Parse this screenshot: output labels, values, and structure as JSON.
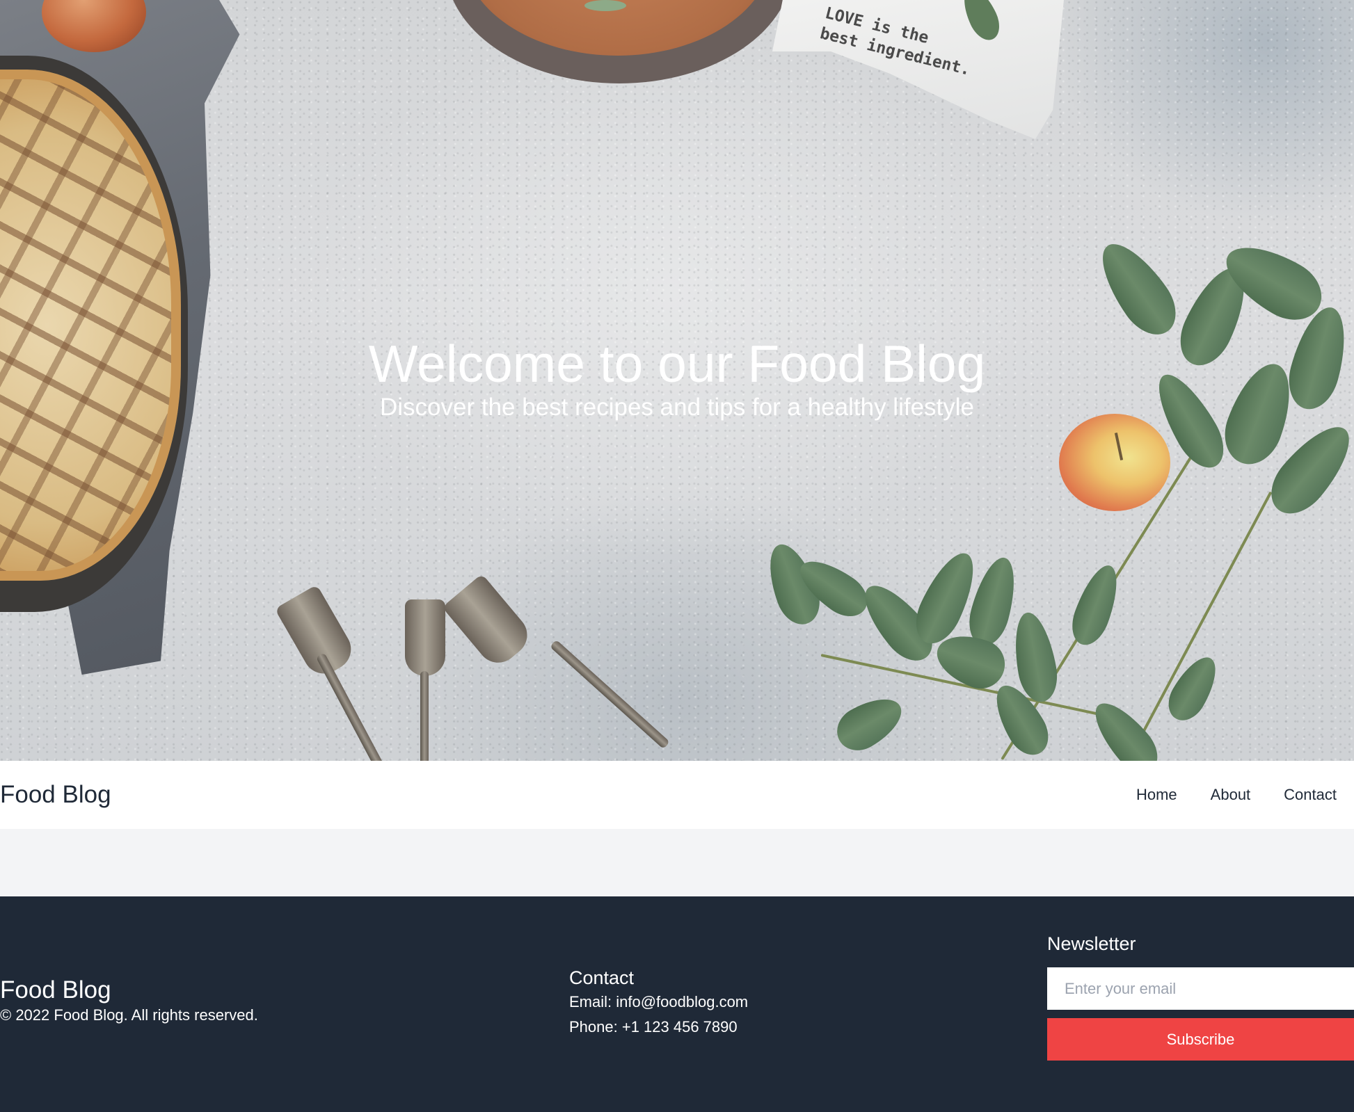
{
  "hero": {
    "title": "Welcome to our Food Blog",
    "subtitle": "Discover the best recipes and tips for a healthy lifestyle",
    "image": {
      "description": "Overhead photo of a lattice pie, grey napkin, wooden plate, printed tea towel, apples, forks and eucalyptus branches on a concrete surface",
      "towel_print": [
        "LOVE is the",
        "best ingredient."
      ]
    }
  },
  "navbar": {
    "brand": "Food Blog",
    "links": [
      {
        "label": "Home"
      },
      {
        "label": "About"
      },
      {
        "label": "Contact"
      }
    ]
  },
  "footer": {
    "brand": "Food Blog",
    "copyright": "© 2022 Food Blog. All rights reserved.",
    "contact": {
      "heading": "Contact",
      "email": "Email: info@foodblog.com",
      "phone": "Phone: +1 123 456 7890"
    },
    "newsletter": {
      "heading": "Newsletter",
      "input_value": "",
      "input_placeholder": "Enter your email",
      "button_label": "Subscribe"
    }
  },
  "colors": {
    "nav_bg": "#ffffff",
    "page_bg": "#f3f4f6",
    "footer_bg": "#1f2937",
    "text_dark": "#1f2937",
    "accent": "#ef4444",
    "placeholder": "#9ca3af"
  }
}
